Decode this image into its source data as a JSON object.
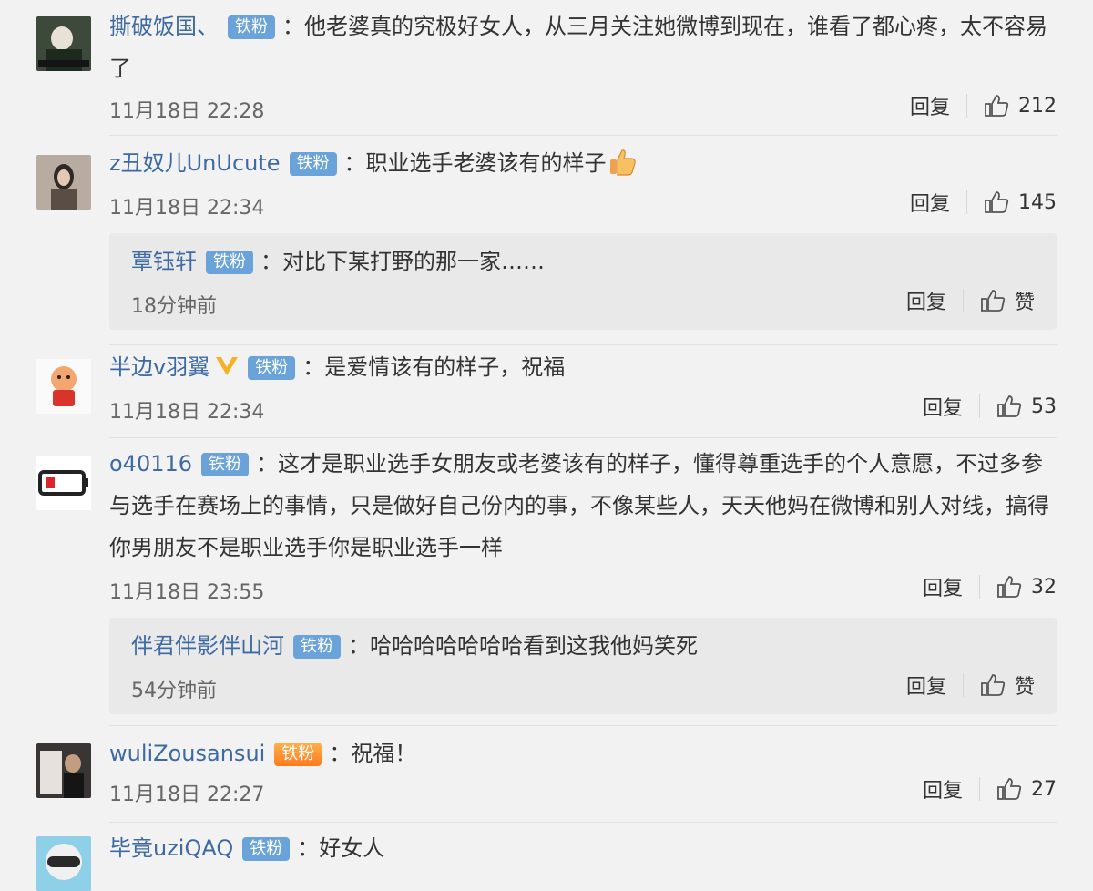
{
  "labels": {
    "reply": "回复",
    "like": "赞"
  },
  "comments": [
    {
      "user": "撕破饭国、",
      "badge": "铁粉",
      "text": "：他老婆真的究极好女人，从三月关注她微博到现在，谁看了都心疼，太不容易了",
      "time": "11月18日 22:28",
      "likes": "212"
    },
    {
      "user": "z丑奴儿UnUcute",
      "badge": "铁粉",
      "text": "：职业选手老婆该有的样子",
      "time": "11月18日 22:34",
      "likes": "145",
      "reply": {
        "user": "覃钰轩",
        "badge": "铁粉",
        "text": "：对比下某打野的那一家……",
        "time": "18分钟前"
      }
    },
    {
      "user": "半边v羽翼",
      "badge": "铁粉",
      "text": "：是爱情该有的样子，祝福",
      "time": "11月18日 22:34",
      "likes": "53"
    },
    {
      "user": "o40116",
      "badge": "铁粉",
      "text": "：这才是职业选手女朋友或老婆该有的样子，懂得尊重选手的个人意愿，不过多参与选手在赛场上的事情，只是做好自己份内的事，不像某些人，天天他妈在微博和别人对线，搞得你男朋友不是职业选手你是职业选手一样",
      "time": "11月18日 23:55",
      "likes": "32",
      "reply": {
        "user": "伴君伴影伴山河",
        "badge": "铁粉",
        "text": "：哈哈哈哈哈哈哈看到这我他妈笑死",
        "time": "54分钟前"
      }
    },
    {
      "user": "wuliZousansui",
      "badge": "铁粉",
      "text": "：祝福！",
      "time": "11月18日 22:27",
      "likes": "27"
    },
    {
      "user": "毕竟uziQAQ",
      "badge": "铁粉",
      "text": "：好女人"
    }
  ]
}
